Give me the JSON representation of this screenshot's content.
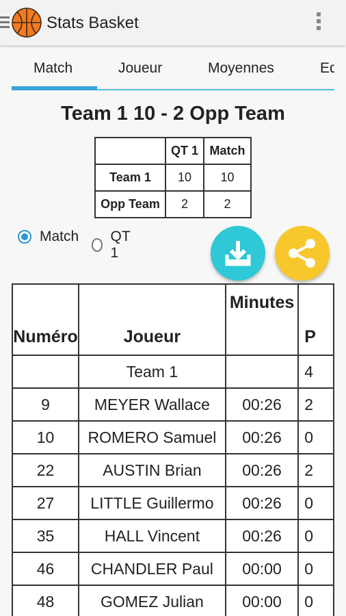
{
  "app": {
    "title": "Stats Basket"
  },
  "tabs": [
    {
      "label": "Match",
      "active": true
    },
    {
      "label": "Joueur",
      "active": false
    },
    {
      "label": "Moyennes",
      "active": false
    },
    {
      "label": "Eq",
      "active": false
    }
  ],
  "score_title": "Team 1 10 - 2 Opp Team",
  "score_table": {
    "headers": [
      "QT 1",
      "Match"
    ],
    "rows": [
      {
        "team": "Team 1",
        "qt1": "10",
        "match": "10"
      },
      {
        "team": "Opp Team",
        "qt1": "2",
        "match": "2"
      }
    ]
  },
  "period_filter": {
    "options": [
      "Match",
      "QT 1"
    ],
    "selected": "Match"
  },
  "colors": {
    "accent": "#33a6da",
    "download_fab": "#2ec8d6",
    "share_fab": "#f7c72c"
  },
  "actions": {
    "download_icon": "download-icon",
    "share_icon": "share-icon"
  },
  "player_table": {
    "headers": [
      "Numéro",
      "Joueur",
      "Minutes",
      "P"
    ],
    "team_row": {
      "number": "",
      "player": "Team 1",
      "minutes": "",
      "next": "4"
    },
    "rows": [
      {
        "number": "9",
        "player": "MEYER Wallace",
        "minutes": "00:26",
        "next": "2"
      },
      {
        "number": "10",
        "player": "ROMERO Samuel",
        "minutes": "00:26",
        "next": "0"
      },
      {
        "number": "22",
        "player": "AUSTIN Brian",
        "minutes": "00:26",
        "next": "2"
      },
      {
        "number": "27",
        "player": "LITTLE Guillermo",
        "minutes": "00:26",
        "next": "0"
      },
      {
        "number": "35",
        "player": "HALL Vincent",
        "minutes": "00:26",
        "next": "0"
      },
      {
        "number": "46",
        "player": "CHANDLER Paul",
        "minutes": "00:00",
        "next": "0"
      },
      {
        "number": "48",
        "player": "GOMEZ Julian",
        "minutes": "00:00",
        "next": "0"
      }
    ]
  }
}
